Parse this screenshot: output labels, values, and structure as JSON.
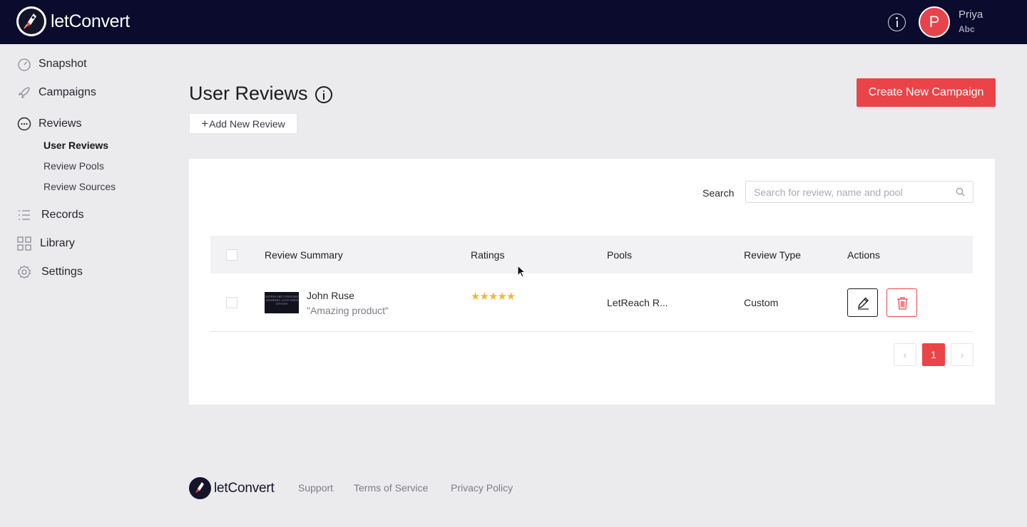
{
  "brand": {
    "logo_light": "let",
    "logo_bold": "Convert"
  },
  "topbar": {
    "user_name": "Priya",
    "user_org": "Abc",
    "avatar_letter": "P"
  },
  "sidebar": {
    "items": [
      {
        "label": "Snapshot",
        "icon": "gauge-icon"
      },
      {
        "label": "Campaigns",
        "icon": "rocket-icon"
      },
      {
        "label": "Reviews",
        "icon": "chat-bubble-icon"
      },
      {
        "label": "Records",
        "icon": "list-icon"
      },
      {
        "label": "Library",
        "icon": "grid-icon"
      },
      {
        "label": "Settings",
        "icon": "gear-icon"
      }
    ],
    "reviews_sub": [
      "User Reviews",
      "Review Pools",
      "Review Sources"
    ],
    "active_sub": "User Reviews"
  },
  "page": {
    "title": "User Reviews",
    "add_button": "Add New Review",
    "create_button": "Create New Campaign"
  },
  "search": {
    "label": "Search",
    "placeholder": "Search for review, name and pool"
  },
  "table": {
    "columns": [
      "Review Summary",
      "Ratings",
      "Pools",
      "Review Type",
      "Actions"
    ],
    "rows": [
      {
        "thumbnail_text": "HATERS ARE CONFUSED ADMIRERS. LOVE THEM ANYWAY",
        "name": "John Ruse",
        "quote": "\"Amazing product\"",
        "rating": 5,
        "stars": "★★★★★",
        "pool": "LetReach R...",
        "review_type": "Custom"
      }
    ]
  },
  "pagination": {
    "prev": "‹",
    "current": "1",
    "next": "›"
  },
  "footer": {
    "links": [
      "Support",
      "Terms of Service",
      "Privacy Policy"
    ]
  },
  "colors": {
    "accent": "#ea4448",
    "topbar": "#0b0b2e",
    "star": "#f0b63a"
  }
}
